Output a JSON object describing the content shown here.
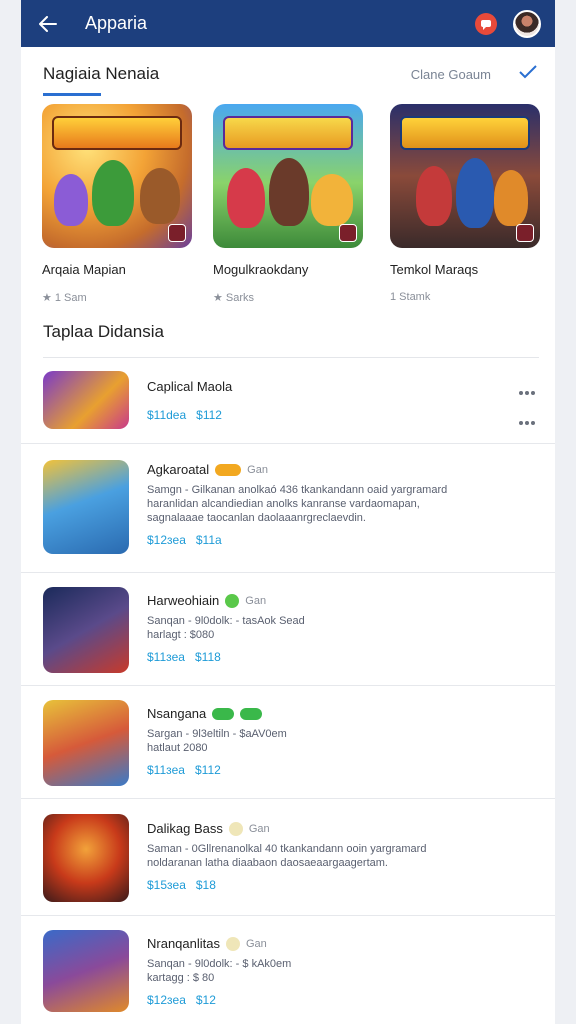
{
  "appbar": {
    "title": "Apparia"
  },
  "featured": {
    "title": "Nagiaia Nenaia",
    "see_all": "Clane Goaum",
    "cards": [
      {
        "name": "Arqaia Mapian",
        "meta": "1 Sam"
      },
      {
        "name": "Mogulkraokdany",
        "meta": "Sarks"
      },
      {
        "name": "Temkol Maraqs",
        "meta": "1 Stamk"
      }
    ]
  },
  "list": {
    "title": "Taplaa Didansia",
    "items": [
      {
        "title": "Caplical Maola",
        "tag": "",
        "desc": [],
        "price1": "$11dea",
        "price2": "$112"
      },
      {
        "title": "Agkaroatal",
        "tag": "Gan",
        "desc": [
          "Samgn - Gilkanan anolkaó 436 tkankandann oaid yargramard",
          "haranlidan alcandiedian anolks kanranse vardaomapan,",
          "sagnalaaae taocanlan daolaaanrgreclaevdin."
        ],
        "price1": "$12ɜea",
        "price2": "$11a"
      },
      {
        "title": "Harweohiain",
        "tag": "Gan",
        "desc": [
          "Sanqan - 9l0dolk: - tasAok Sead",
          "harlagt : $080"
        ],
        "price1": "$11ɜea",
        "price2": "$118"
      },
      {
        "title": "Nsangana",
        "tag": "",
        "desc": [
          "Sargan - 9l3eltiln - $aAV0em",
          "hatlaut 2080"
        ],
        "price1": "$11ɜea",
        "price2": "$112"
      },
      {
        "title": "Dalikag Bass",
        "tag": "Gan",
        "desc": [
          "Saman - 0Gllrenanolkal 40 tkankandann ooin yargramard",
          "noldaranan latha diaabaon daosaeaargaagertam."
        ],
        "price1": "$15ɜea",
        "price2": "$18"
      },
      {
        "title": "Nranqanlitas",
        "tag": "Gan",
        "desc": [
          "Sanqan - 9l0dolk: - $ kAk0em",
          "kartagg : $ 80"
        ],
        "price1": "$12ɜea",
        "price2": "$12"
      }
    ]
  },
  "colors": {
    "appbar": "#1d3f7e",
    "accent": "#2a6fd1",
    "price": "#1e9bd7"
  }
}
